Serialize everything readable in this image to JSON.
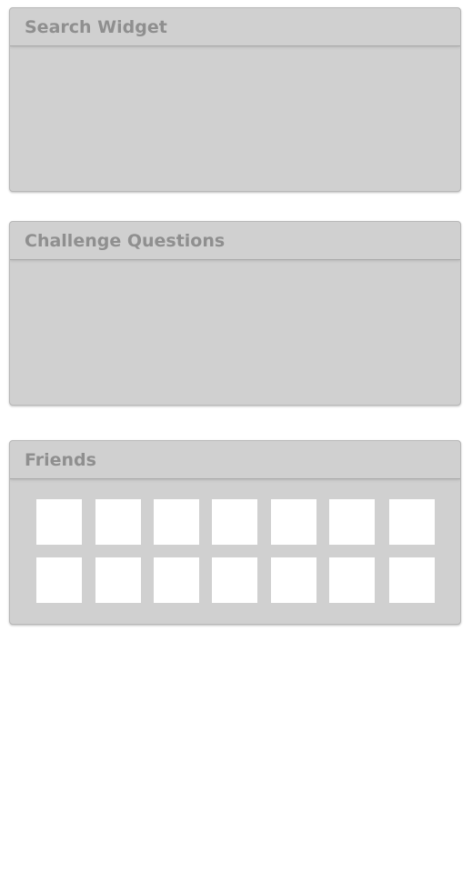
{
  "widgets": {
    "search": {
      "title": "Search Widget"
    },
    "challenge": {
      "title": "Challenge Questions"
    },
    "friends": {
      "title": "Friends",
      "slot_rows": 2,
      "slot_cols": 7
    }
  },
  "colors": {
    "panel_bg": "#d0d0d0",
    "title_text": "#8f8f8f",
    "slot_bg": "#ffffff",
    "page_bg": "#ffffff"
  }
}
